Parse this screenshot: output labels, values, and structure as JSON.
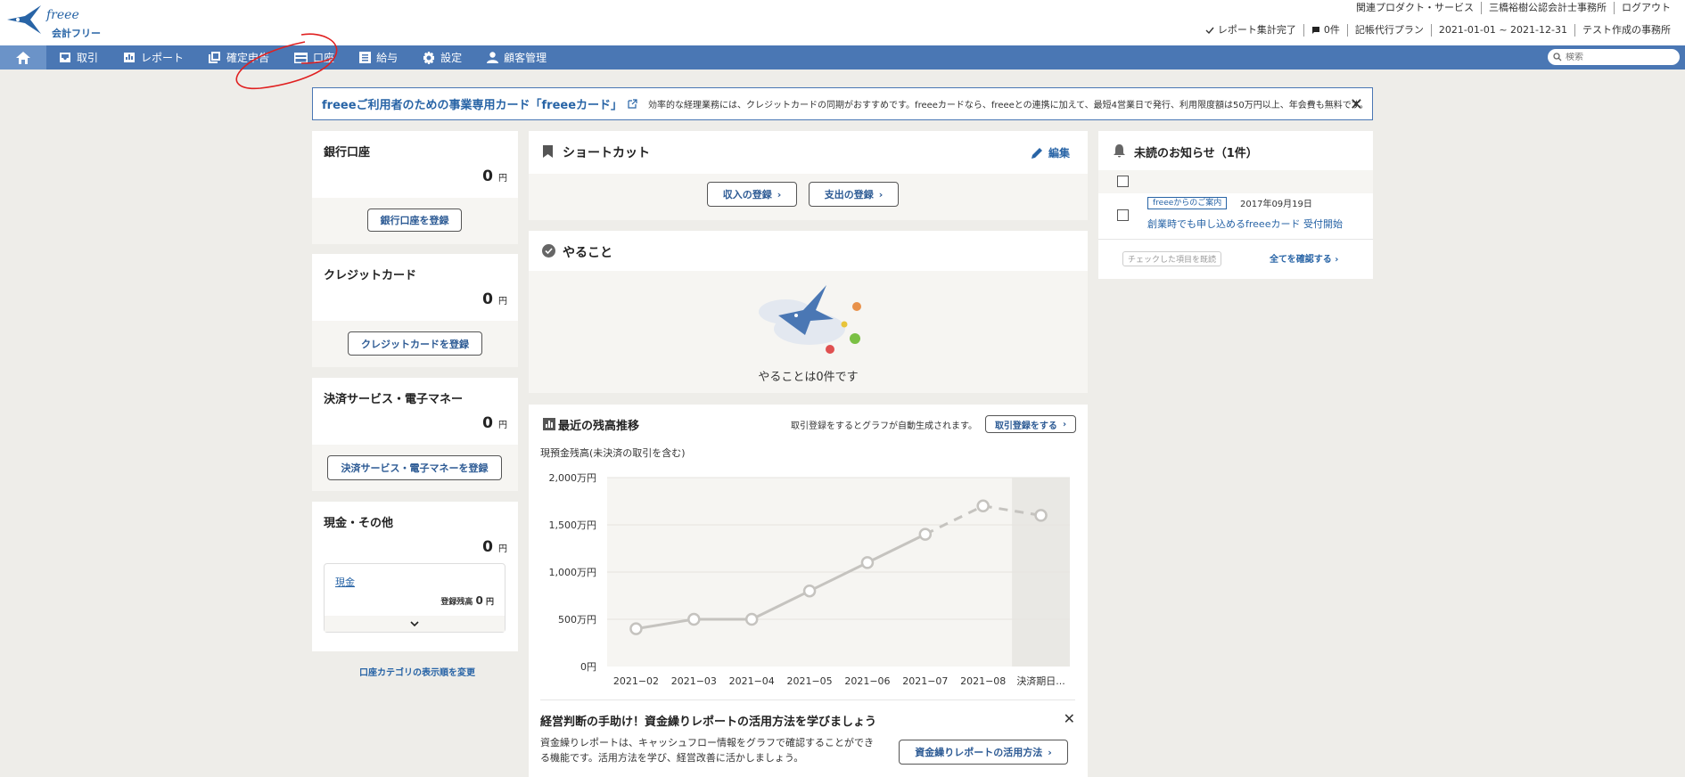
{
  "header": {
    "logo_freee": "freee",
    "logo_text": "会計フリー",
    "links": [
      "関連プロダクト・サービス",
      "三橋裕樹公認会計士事務所",
      "ログアウト"
    ],
    "status_report": "レポート集計完了",
    "notifications": "0件",
    "plan": "記帳代行プラン",
    "period": "2021-01-01 ~ 2021-12-31",
    "office": "テスト作成の事務所"
  },
  "nav": {
    "items": [
      "取引",
      "レポート",
      "確定申告",
      "口座",
      "給与",
      "設定",
      "顧客管理"
    ],
    "search_placeholder": "検索"
  },
  "banner": {
    "title": "freeeご利用者のための事業専用カード「freeeカード」",
    "desc": "効率的な経理業務には、クレジットカードの同期がおすすめです。freeeカードなら、freeeとの連携に加えて、最短4営業日で発行、利用限度額は50万円以上、年会費も無料です。"
  },
  "accounts": {
    "bank": {
      "title": "銀行口座",
      "amount": "0",
      "unit": "円",
      "button": "銀行口座を登録"
    },
    "credit": {
      "title": "クレジットカード",
      "amount": "0",
      "unit": "円",
      "button": "クレジットカードを登録"
    },
    "payment": {
      "title": "決済サービス・電子マネー",
      "amount": "0",
      "unit": "円",
      "button": "決済サービス・電子マネーを登録"
    },
    "cash": {
      "title": "現金・その他",
      "amount": "0",
      "unit": "円",
      "item_name": "現金",
      "balance_label": "登録残高",
      "balance_amount": "0",
      "balance_unit": "円"
    },
    "change_order": "口座カテゴリの表示順を変更"
  },
  "shortcut": {
    "title": "ショートカット",
    "edit": "編集",
    "income": "収入の登録",
    "expense": "支出の登録"
  },
  "todo": {
    "title": "やること",
    "empty": "やることは0件です"
  },
  "balance": {
    "title": "最近の残高推移",
    "hint": "取引登録をするとグラフが自動生成されます。",
    "button": "取引登録をする",
    "subtitle": "現預金残高(未決済の取引を含む)"
  },
  "chart_data": {
    "type": "line",
    "categories": [
      "2021−02",
      "2021−03",
      "2021−04",
      "2021−05",
      "2021−06",
      "2021−07",
      "2021−08",
      "決済期日..."
    ],
    "values": [
      400,
      500,
      500,
      800,
      1100,
      1400,
      1700,
      1600
    ],
    "y_ticks": [
      "0円",
      "500万円",
      "1,000万円",
      "1,500万円",
      "2,000万円"
    ],
    "ylim": [
      0,
      2000
    ],
    "grid": true,
    "solid_until_index": 5,
    "colors": {
      "line": "#c5c3bf",
      "highlight_bg": "#e9e8e4",
      "plot_bg": "#f6f5f2"
    }
  },
  "promo": {
    "title": "経営判断の手助け！資金繰りレポートの活用方法を学びましょう",
    "desc1": "資金繰りレポートは、キャッシュフロー情報をグラフで確認することができ",
    "desc2": "る機能です。活用方法を学び、経営改善に活かしましょう。",
    "button": "資金繰りレポートの活用方法"
  },
  "notice": {
    "title": "未読のお知らせ（1件）",
    "tag": "freeeからのご案内",
    "date": "2017年09月19日",
    "link": "創業時でも申し込めるfreeeカード 受付開始",
    "mark_read": "チェックした項目を既読",
    "see_all": "全てを確認する"
  },
  "colors": {
    "brand": "#4a77b4",
    "link": "#2864a6",
    "bg": "#eeede9"
  }
}
